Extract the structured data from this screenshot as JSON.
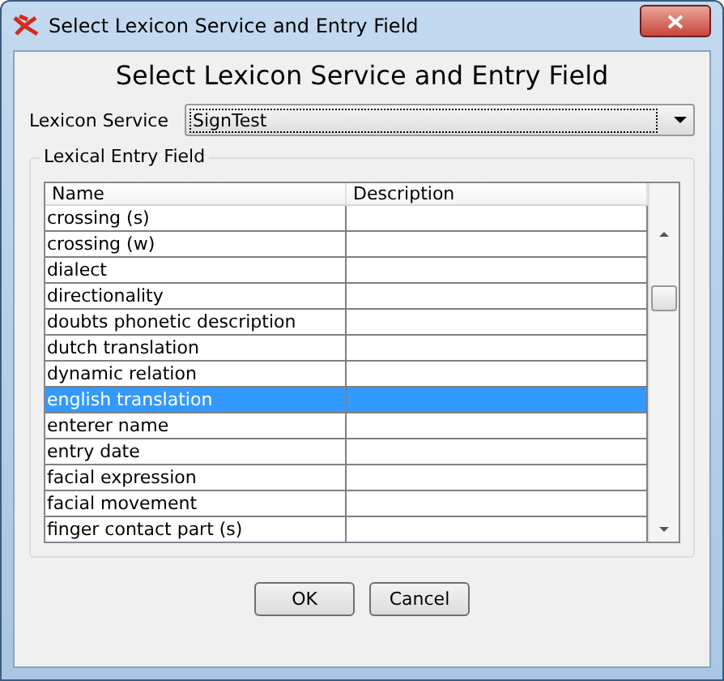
{
  "window": {
    "title": "Select Lexicon Service and Entry Field"
  },
  "heading": "Select Lexicon Service and Entry Field",
  "lexicon_service": {
    "label": "Lexicon Service",
    "value": "SignTest"
  },
  "group": {
    "title": "Lexical Entry Field"
  },
  "table": {
    "columns": [
      "Name",
      "Description"
    ],
    "rows": [
      {
        "name": "crossing (s)",
        "selected": false
      },
      {
        "name": "crossing (w)",
        "selected": false
      },
      {
        "name": "dialect",
        "selected": false
      },
      {
        "name": "directionality",
        "selected": false
      },
      {
        "name": "doubts phonetic description",
        "selected": false
      },
      {
        "name": "dutch translation",
        "selected": false
      },
      {
        "name": "dynamic relation",
        "selected": false
      },
      {
        "name": "english translation",
        "selected": true
      },
      {
        "name": "enterer name",
        "selected": false
      },
      {
        "name": "entry date",
        "selected": false
      },
      {
        "name": "facial expression",
        "selected": false
      },
      {
        "name": "facial movement",
        "selected": false
      },
      {
        "name": "finger contact part (s)",
        "selected": false
      }
    ]
  },
  "buttons": [
    "OK",
    "Cancel"
  ]
}
